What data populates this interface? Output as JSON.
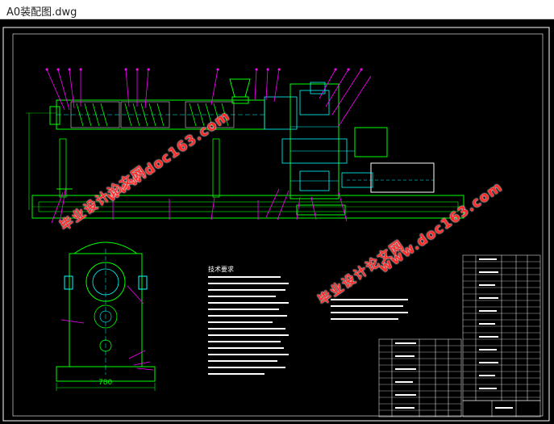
{
  "window": {
    "title": "A0装配图.dwg"
  },
  "drawing": {
    "dimension_label": "780",
    "notes_title": "技术要求",
    "watermark": {
      "url": "www.doc163.com",
      "cn": "毕业设计论文网"
    },
    "colors": {
      "background": "#000000",
      "frame": "#ffffff",
      "machine": "#00ff00",
      "parts": "#00ffff",
      "leaders": "#ff00ff",
      "dims": "#00ff00",
      "text": "#ffffff",
      "watermark": "#ff2a2a"
    }
  }
}
